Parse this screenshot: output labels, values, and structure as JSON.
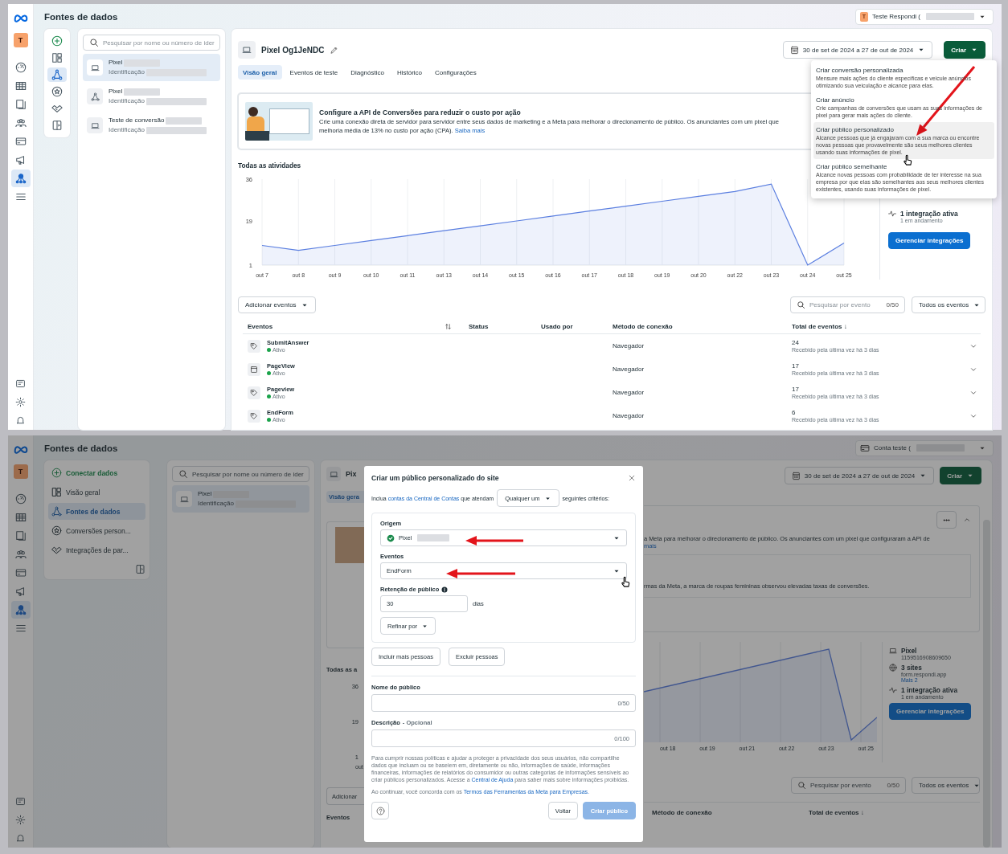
{
  "top": {
    "title": "Fontes de dados",
    "account": {
      "avatar": "T",
      "name": "Teste Respondi ("
    },
    "rail": {
      "avatar": "T",
      "items": [
        {
          "selected": false
        },
        {
          "selected": false
        },
        {
          "selected": false
        },
        {
          "selected": false
        },
        {
          "selected": false
        },
        {
          "selected": false
        },
        {
          "selected": true
        },
        {
          "selected": false
        }
      ]
    },
    "tools": [
      {
        "selected": false
      },
      {
        "selected": false
      },
      {
        "selected": true
      },
      {
        "selected": false
      },
      {
        "selected": false
      },
      {
        "selected": false
      }
    ],
    "search": {
      "placeholder": "Pesquisar por nome ou número de ider"
    },
    "sources": [
      {
        "kind": "laptop",
        "name": "Pixel",
        "id_label": "Identificação",
        "selected": true
      },
      {
        "kind": "network",
        "name": "Pixel",
        "id_label": "Identificação",
        "selected": false
      },
      {
        "kind": "laptop",
        "name": "Teste de conversão",
        "id_label": "Identificação",
        "selected": false
      }
    ],
    "header": {
      "title": "Pixel Og1JeNDC",
      "date_range": "30 de set de 2024 a 27 de out de 2024",
      "create_button": "Criar"
    },
    "tabs": [
      {
        "label": "Visão geral",
        "selected": true
      },
      {
        "label": "Eventos de teste",
        "selected": false
      },
      {
        "label": "Diagnóstico",
        "selected": false
      },
      {
        "label": "Histórico",
        "selected": false
      },
      {
        "label": "Configurações",
        "selected": false
      }
    ],
    "banner": {
      "title": "Configure a API de Conversões para reduzir o custo por ação",
      "text": "Crie uma conexão direta de servidor para servidor entre seus dados de marketing e a Meta para melhorar o direcionamento de público. Os anunciantes com um pixel que",
      "text_2": "melhoria média de 13% no custo por ação (CPA).",
      "link": "Saiba mais"
    },
    "activity": {
      "title": "Todas as atividades",
      "chart_data": {
        "type": "line",
        "categories": [
          "out 7",
          "out 8",
          "out 9",
          "out 10",
          "out 11",
          "out 13",
          "out 14",
          "out 15",
          "out 16",
          "out 17",
          "out 18",
          "out 19",
          "out 20",
          "out 22",
          "out 23",
          "out 24",
          "out 25"
        ],
        "series": [
          {
            "color": "#5b7fe0",
            "values": [
              9,
              7,
              9,
              11,
              13,
              15,
              17,
              19,
              21,
              23,
              25,
              27,
              29,
              31,
              34,
              1,
              10
            ]
          }
        ],
        "ylim": [
          1,
          36
        ],
        "yticks": [
          1,
          19,
          36
        ],
        "grid": true
      }
    },
    "integrations": {
      "title": "1 integração ativa",
      "subtitle": "1 em andamento",
      "button": "Gerenciar integrações"
    },
    "toolbar": {
      "add_button": "Adicionar eventos",
      "search": {
        "placeholder": "Pesquisar por evento",
        "counter": "0/50"
      },
      "filter": "Todos os eventos"
    },
    "table": {
      "columns": [
        "Eventos",
        "Status",
        "Usado por",
        "Método de conexão",
        "Total de eventos ↓"
      ],
      "rows": [
        {
          "kind": "tag",
          "name": "SubmitAnswer",
          "status": "Ativo",
          "method": "Navegador",
          "total": "24",
          "received": "Recebido pela última vez há 3 dias"
        },
        {
          "kind": "page",
          "name": "PageView",
          "status": "Ativo",
          "method": "Navegador",
          "total": "17",
          "received": "Recebido pela última vez há 3 dias"
        },
        {
          "kind": "tag",
          "name": "Pageview",
          "status": "Ativo",
          "method": "Navegador",
          "total": "17",
          "received": "Recebido pela última vez há 3 dias"
        },
        {
          "kind": "tag",
          "name": "EndForm",
          "status": "Ativo",
          "method": "Navegador",
          "total": "6",
          "received": "Recebido pela última vez há 3 dias"
        }
      ]
    },
    "menu": {
      "items": [
        {
          "title": "Criar conversão personalizada",
          "description": "Mensure mais ações do cliente específicas e veicule anúncios otimizando sua veiculação e alcance para elas.",
          "selected": false
        },
        {
          "title": "Criar anúncio",
          "description": "Crie campanhas de conversões que usam as suas informações de pixel para gerar mais ações do cliente.",
          "selected": false
        },
        {
          "title": "Criar público personalizado",
          "description": "Alcance pessoas que já engajaram com a sua marca ou encontre novas pessoas que provavelmente são seus melhores clientes usando suas informações de pixel.",
          "selected": true
        },
        {
          "title": "Criar público semelhante",
          "description": "Alcance novas pessoas com probabilidade de ter interesse na sua empresa por que elas são semelhantes aos seus melhores clientes existentes, usando suas informações de pixel.",
          "selected": false
        }
      ]
    }
  },
  "bottom": {
    "title": "Fontes de dados",
    "account": {
      "name": "Conta teste ("
    },
    "rail": {
      "avatar": "T",
      "items": [
        {
          "selected": false
        },
        {
          "selected": false
        },
        {
          "selected": false
        },
        {
          "selected": false
        },
        {
          "selected": false
        },
        {
          "selected": false
        },
        {
          "selected": true
        },
        {
          "selected": false
        }
      ]
    },
    "nav": [
      {
        "kind": "action",
        "label": "Conectar dados",
        "selected": false
      },
      {
        "kind": "page",
        "label": "Visão geral",
        "selected": false
      },
      {
        "kind": "page",
        "label": "Fontes de dados",
        "selected": true
      },
      {
        "kind": "page",
        "label": "Conversões person...",
        "selected": false
      },
      {
        "kind": "page",
        "label": "Integrações de par...",
        "selected": false
      }
    ],
    "search": {
      "placeholder": "Pesquisar por nome ou número de ider"
    },
    "sources": [
      {
        "kind": "laptop",
        "name": "Pixel",
        "id_label": "Identificação",
        "selected": true
      }
    ],
    "background": {
      "title_fragment": "Pix",
      "tab_fragment": "Visão gera",
      "section_fragment": "Todas as a",
      "y_ticks": [
        "36",
        "19",
        "1"
      ],
      "x_fragment": "out",
      "add_fragment": "Adicionar",
      "column_fragment": "Eventos",
      "date_range": "30 de set de 2024 a 27 de out de 2024",
      "create_button": "Criar",
      "banner_text": "a Meta para melhorar o direcionamento de público. Os anunciantes com um pixel que configuraram a API de",
      "banner_link": "mais",
      "case_text": "rmas da Meta, a marca de roupas femininas observou elevadas taxas de conversões.",
      "x_labels": [
        "out 18",
        "out 19",
        "out 21",
        "out 22",
        "out 23",
        "out 25"
      ],
      "info": [
        {
          "kind": "pixel",
          "title": "Pixel",
          "line": "1159516908609650"
        },
        {
          "kind": "sites",
          "title": "3 sites",
          "line": "form.respondi.app",
          "link": "Mais 2"
        },
        {
          "kind": "integration",
          "title": "1 integração ativa",
          "line": "1 em andamento"
        }
      ],
      "manage_button": "Gerenciar integrações",
      "search": {
        "placeholder": "Pesquisar por evento",
        "counter": "0/50"
      },
      "filter": "Todos os eventos",
      "columns": [
        "Método de conexão",
        "Total de eventos ↓"
      ]
    },
    "modal": {
      "title": "Criar um público personalizado do site",
      "intro": {
        "before": "Inclua",
        "link": "contas da Central de Contas",
        "after": "que atendam",
        "select": "Qualquer um",
        "tail": "seguintes critérios:"
      },
      "origin": {
        "label": "Origem",
        "value": "Pixel"
      },
      "events": {
        "label": "Eventos",
        "value": "EndForm"
      },
      "retention": {
        "label": "Retenção de público",
        "value": "30",
        "unit": "dias"
      },
      "refine_button": "Refinar por",
      "include_button": "Incluir mais pessoas",
      "exclude_button": "Excluir pessoas",
      "name_field": {
        "label": "Nome do público",
        "counter": "0/50"
      },
      "description_field": {
        "label": "Descrição",
        "optional": "- Opcional",
        "counter": "0/100"
      },
      "policy": {
        "text": "Para cumprir nossas políticas e ajudar a proteger a privacidade dos seus usuários, não compartilhe dados que incluam ou se baseiem em, diretamente ou não, informações de saúde, informações financeiras, informações de relatórios do consumidor ou outras categorias de informações sensíveis ao criar públicos personalizados. Acesse a",
        "link": "Central de Ajuda",
        "after": "para saber mais sobre informações proibidas."
      },
      "terms": {
        "text": "Ao continuar, você concorda com os",
        "link": "Termos das Ferramentas da Meta para Empresas."
      },
      "back_button": "Voltar",
      "create_button": {
        "label": "Criar público",
        "disabled": true
      }
    }
  }
}
